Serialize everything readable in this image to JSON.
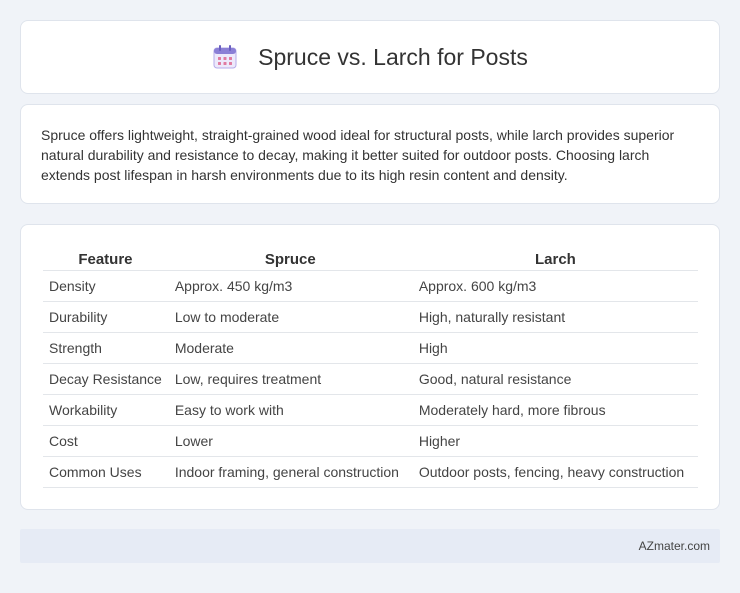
{
  "header": {
    "title": "Spruce vs. Larch for Posts",
    "icon": "calendar-icon"
  },
  "summary": {
    "text": "Spruce offers lightweight, straight-grained wood ideal for structural posts, while larch provides superior natural durability and resistance to decay, making it better suited for outdoor posts. Choosing larch extends post lifespan in harsh environments due to its high resin content and density."
  },
  "table": {
    "headers": [
      "Feature",
      "Spruce",
      "Larch"
    ],
    "rows": [
      [
        "Density",
        "Approx. 450 kg/m3",
        "Approx. 600 kg/m3"
      ],
      [
        "Durability",
        "Low to moderate",
        "High, naturally resistant"
      ],
      [
        "Strength",
        "Moderate",
        "High"
      ],
      [
        "Decay Resistance",
        "Low, requires treatment",
        "Good, natural resistance"
      ],
      [
        "Workability",
        "Easy to work with",
        "Moderately hard, more fibrous"
      ],
      [
        "Cost",
        "Lower",
        "Higher"
      ],
      [
        "Common Uses",
        "Indoor framing, general construction",
        "Outdoor posts, fencing, heavy construction"
      ]
    ]
  },
  "footer": {
    "site": "AZmater.com"
  },
  "colors": {
    "background": "#f0f3f8",
    "card": "#ffffff",
    "footer_bg": "#e6ebf5",
    "icon_accent": "#8b7fd6"
  }
}
